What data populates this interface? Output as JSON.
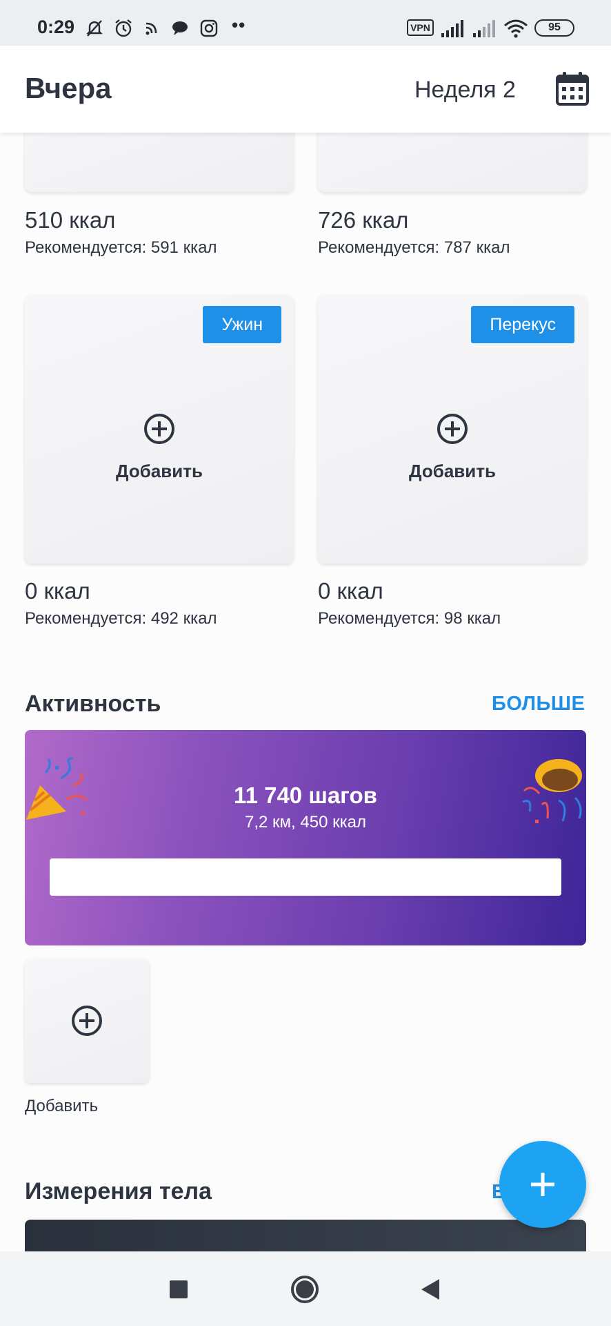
{
  "status_bar": {
    "time": "0:29",
    "dots": "••",
    "vpn": "VPN",
    "battery": "95"
  },
  "header": {
    "title": "Вчера",
    "week": "Неделя 2"
  },
  "meals_top": [
    {
      "kcal": "510 ккал",
      "recommended": "Рекомендуется: 591 ккал"
    },
    {
      "kcal": "726 ккал",
      "recommended": "Рекомендуется: 787 ккал"
    }
  ],
  "meals_bottom": [
    {
      "tag": "Ужин",
      "add_label": "Добавить",
      "kcal": "0 ккал",
      "recommended": "Рекомендуется: 492 ккал"
    },
    {
      "tag": "Перекус",
      "add_label": "Добавить",
      "kcal": "0 ккал",
      "recommended": "Рекомендуется: 98 ккал"
    }
  ],
  "activity": {
    "title": "Активность",
    "more": "БОЛЬШЕ",
    "steps": "11 740 шагов",
    "details": "7,2 км, 450 ккал",
    "progress": 1.0,
    "add_label": "Добавить"
  },
  "body_measurements": {
    "title": "Измерения тела",
    "more_partial": "Б"
  },
  "colors": {
    "accent": "#1e90e8",
    "fab": "#1ea3f2",
    "text": "#2e3541"
  }
}
